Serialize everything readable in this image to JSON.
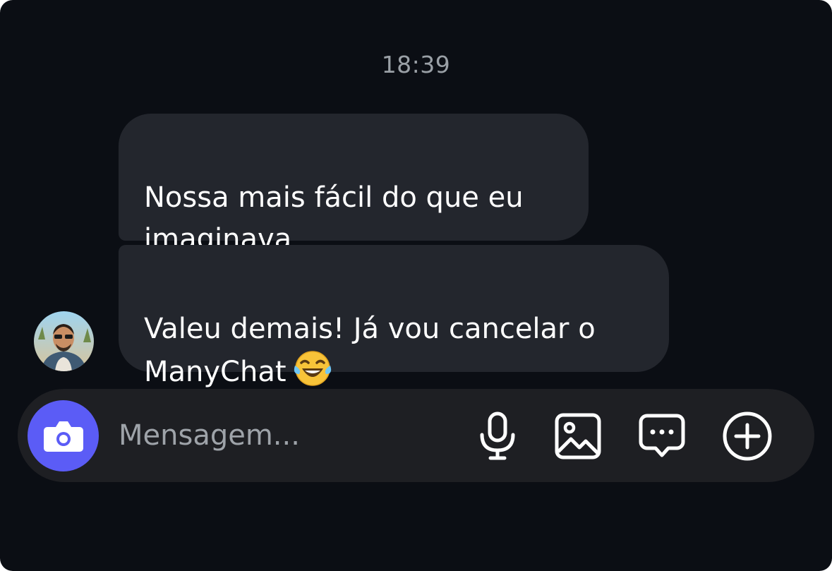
{
  "conversation": {
    "timestamp": "18:39",
    "messages": [
      {
        "text": "Nossa mais fácil do que eu\nimaginava"
      },
      {
        "text": "Valeu demais! Já vou cancelar o\nManyChat",
        "emoji_icon": "tears-of-joy-emoji"
      }
    ]
  },
  "composer": {
    "placeholder": "Mensagem...",
    "value": "",
    "accent_color": "#5b5cf6",
    "icons": [
      "camera-icon",
      "microphone-icon",
      "image-icon",
      "chat-bubble-icon",
      "plus-circle-icon"
    ]
  },
  "colors": {
    "background": "#0b0e14",
    "bubble": "#23262d",
    "composer": "#1e1f23"
  }
}
